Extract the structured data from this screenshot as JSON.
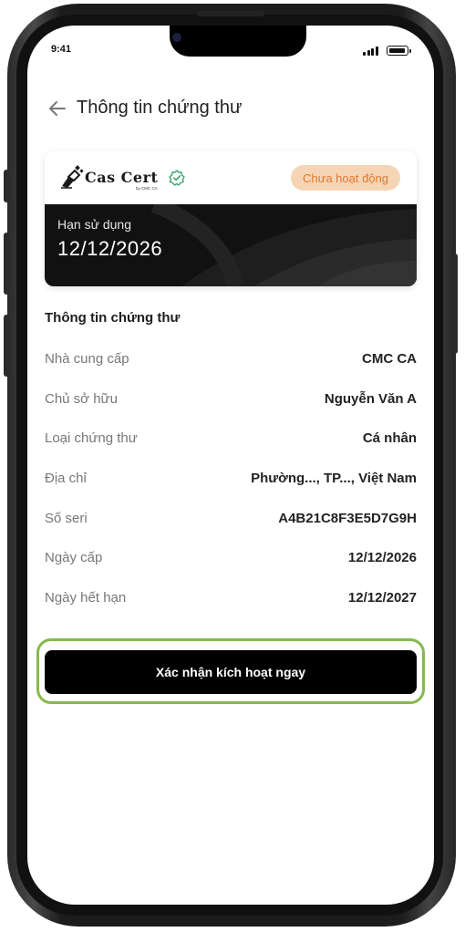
{
  "status_bar": {
    "time": "9:41"
  },
  "header": {
    "title": "Thông tin chứng thư"
  },
  "certificate": {
    "logo_text": "Cas Cert",
    "logo_sub": "by CMC CA",
    "status": "Chưa hoạt động",
    "expiry_label": "Hạn sử dụng",
    "expiry_date": "12/12/2026"
  },
  "info": {
    "title": "Thông tin chứng thư",
    "rows": [
      {
        "label": "Nhà cung cấp",
        "value": "CMC CA"
      },
      {
        "label": "Chủ sở hữu",
        "value": "Nguyễn Văn A"
      },
      {
        "label": "Loại chứng thư",
        "value": "Cá nhân"
      },
      {
        "label": "Địa chỉ",
        "value": "Phường..., TP..., Việt Nam"
      },
      {
        "label": "Số seri",
        "value": "A4B21C8F3E5D7G9H"
      },
      {
        "label": "Ngày cấp",
        "value": "12/12/2026"
      },
      {
        "label": "Ngày hết hạn",
        "value": "12/12/2027"
      }
    ]
  },
  "cta": {
    "label": "Xác nhận kích hoạt ngay"
  },
  "colors": {
    "accent": "#86b84f",
    "badge_bg": "#f6d5b6",
    "badge_text": "#e07a2e",
    "verified": "#3aa36b"
  },
  "icons": [
    "back-arrow-icon",
    "verified-check-icon",
    "signal-icon",
    "battery-icon"
  ]
}
